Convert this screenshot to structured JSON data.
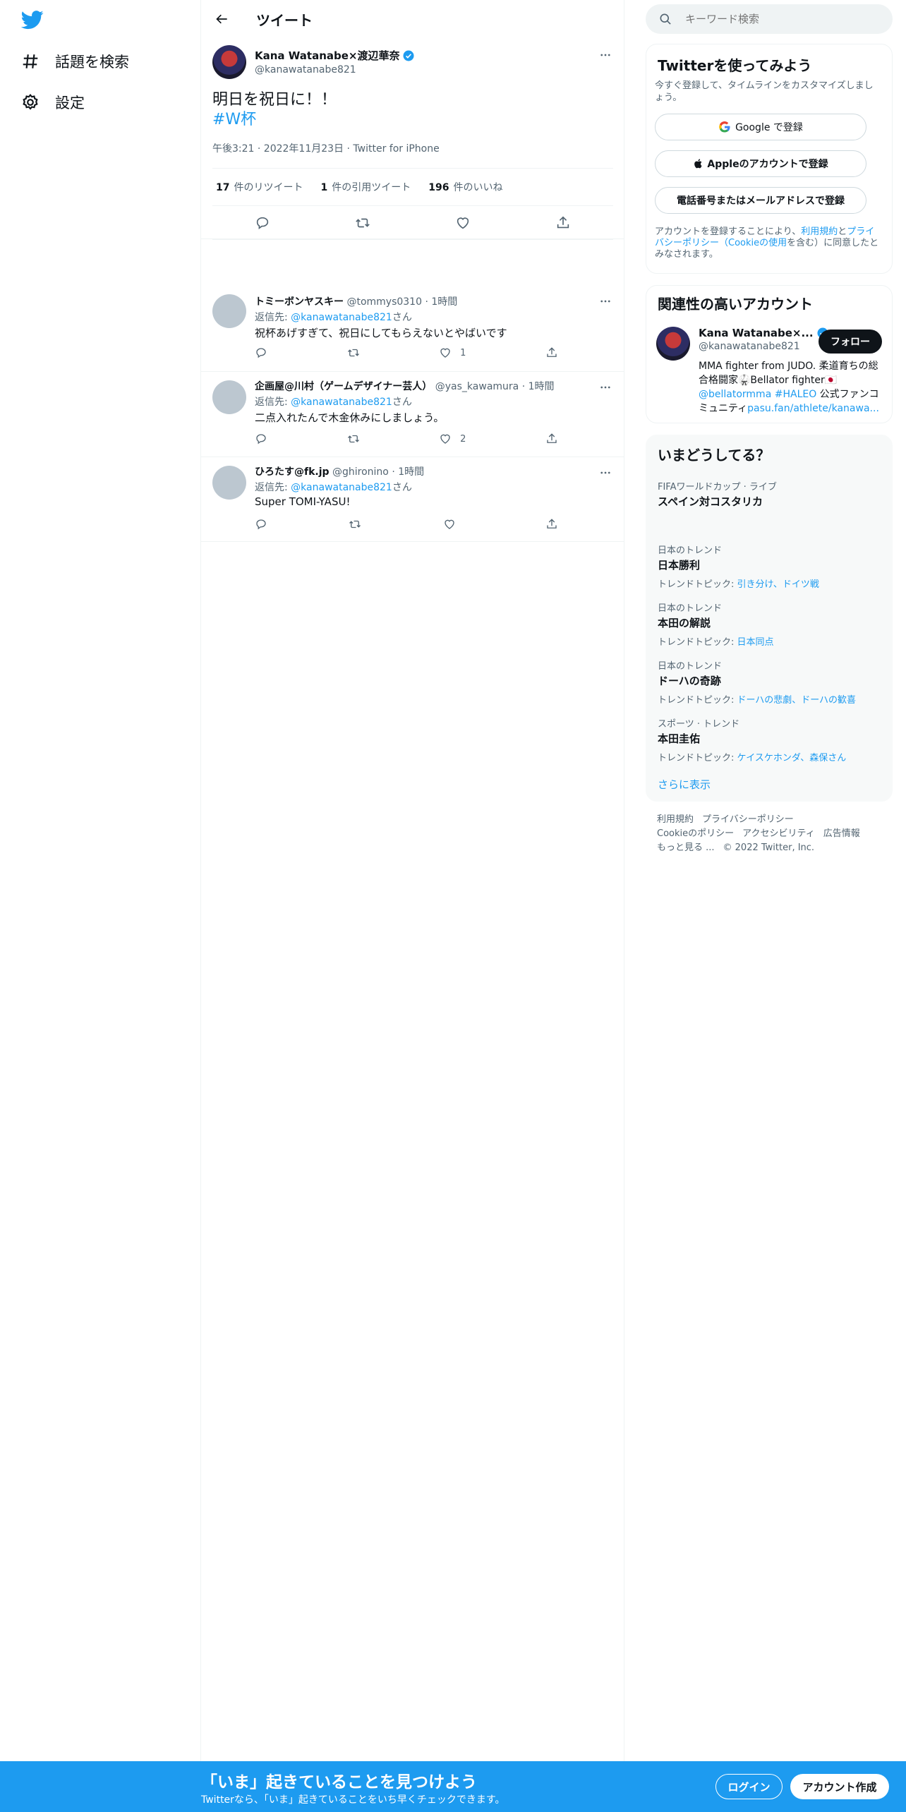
{
  "nav": {
    "items": [
      {
        "label": "話題を検索"
      },
      {
        "label": "設定"
      }
    ]
  },
  "header": {
    "title": "ツイート"
  },
  "tweet": {
    "author_name": "Kana Watanabe×渡辺華奈",
    "author_handle": "@kanawatanabe821",
    "text_line1": "明日を祝日に！！",
    "hashtag": "#W杯",
    "meta": "午後3:21 · 2022年11月23日 · Twitter for iPhone",
    "stats": [
      {
        "count": "17",
        "label": "件のリツイート"
      },
      {
        "count": "1",
        "label": "件の引用ツイート"
      },
      {
        "count": "196",
        "label": "件のいいね"
      }
    ]
  },
  "replies": [
    {
      "name": "トミーボンヤスキー",
      "handle": "@tommys0310",
      "time": "· 1時間",
      "reply_prefix": "返信先: ",
      "reply_to": "@kanawatanabe821",
      "reply_suffix": "さん",
      "text": "祝杯あげすぎて、祝日にしてもらえないとやばいです",
      "likes": "1"
    },
    {
      "name": "企画屋@川村（ゲームデザイナー芸人）",
      "handle": "@yas_kawamura",
      "time": "· 1時間",
      "reply_prefix": "返信先: ",
      "reply_to": "@kanawatanabe821",
      "reply_suffix": "さん",
      "text": "二点入れたんで木金休みにしましょう。",
      "likes": "2"
    },
    {
      "name": "ひろたす@fk.jp",
      "handle": "@ghironino",
      "time": "· 1時間",
      "reply_prefix": "返信先: ",
      "reply_to": "@kanawatanabe821",
      "reply_suffix": "さん",
      "text": "Super TOMI-YASU!",
      "likes": ""
    }
  ],
  "search": {
    "placeholder": "キーワード検索"
  },
  "signup": {
    "title": "Twitterを使ってみよう",
    "subtitle": "今すぐ登録して、タイムラインをカスタマイズしましょう。",
    "google_btn": "Google で登録",
    "apple_btn": "Appleのアカウントで登録",
    "phone_btn": "電話番号またはメールアドレスで登録",
    "legal_1": "アカウントを登録することにより、",
    "legal_link1": "利用規約",
    "legal_2": "と",
    "legal_link2": "プライバシーポリシー（Cookieの使用",
    "legal_3": "を含む）に同意したとみなされます。"
  },
  "related": {
    "title": "関連性の高いアカウント",
    "name": "Kana Watanabe×...",
    "handle": "@kanawatanabe821",
    "follow": "フォロー",
    "bio_1": "MMA fighter from JUDO. 柔道育ちの総合格闘家🥋Bellator fighter🇯🇵",
    "bio_link1": "@bellatormma",
    "bio_link2": "#HALEO",
    "bio_2": " 公式ファンコミュニティ",
    "bio_link3": "pasu.fan/athlete/kanawa..."
  },
  "trends": {
    "title": "いまどうしてる？",
    "items": [
      {
        "context": "FIFAワールドカップ · ライブ",
        "name": "スペイン対コスタリカ",
        "topics_label": "",
        "topics": ""
      },
      {
        "context": "日本のトレンド",
        "name": "日本勝利",
        "topics_label": "トレンドトピック: ",
        "topics": "引き分け、ドイツ戦"
      },
      {
        "context": "日本のトレンド",
        "name": "本田の解説",
        "topics_label": "トレンドトピック: ",
        "topics": "日本同点"
      },
      {
        "context": "日本のトレンド",
        "name": "ドーハの奇跡",
        "topics_label": "トレンドトピック: ",
        "topics": "ドーハの悲劇、ドーハの歓喜"
      },
      {
        "context": "スポーツ · トレンド",
        "name": "本田圭佑",
        "topics_label": "トレンドトピック: ",
        "topics": "ケイスケホンダ、森保さん"
      }
    ],
    "show_more": "さらに表示"
  },
  "footer": {
    "terms": "利用規約",
    "privacy": "プライバシーポリシー",
    "cookie": "Cookieのポリシー",
    "accessibility": "アクセシビリティ",
    "ads": "広告情報",
    "more": "もっと見る ...",
    "copyright": "© 2022 Twitter, Inc."
  },
  "bottombar": {
    "title": "「いま」起きていることを見つけよう",
    "subtitle": "Twitterなら、「いま」起きていることをいち早くチェックできます。",
    "login": "ログイン",
    "signup": "アカウント作成"
  },
  "colors": {
    "accent": "#1d9bf0",
    "text": "#0f1419",
    "muted": "#536471"
  }
}
